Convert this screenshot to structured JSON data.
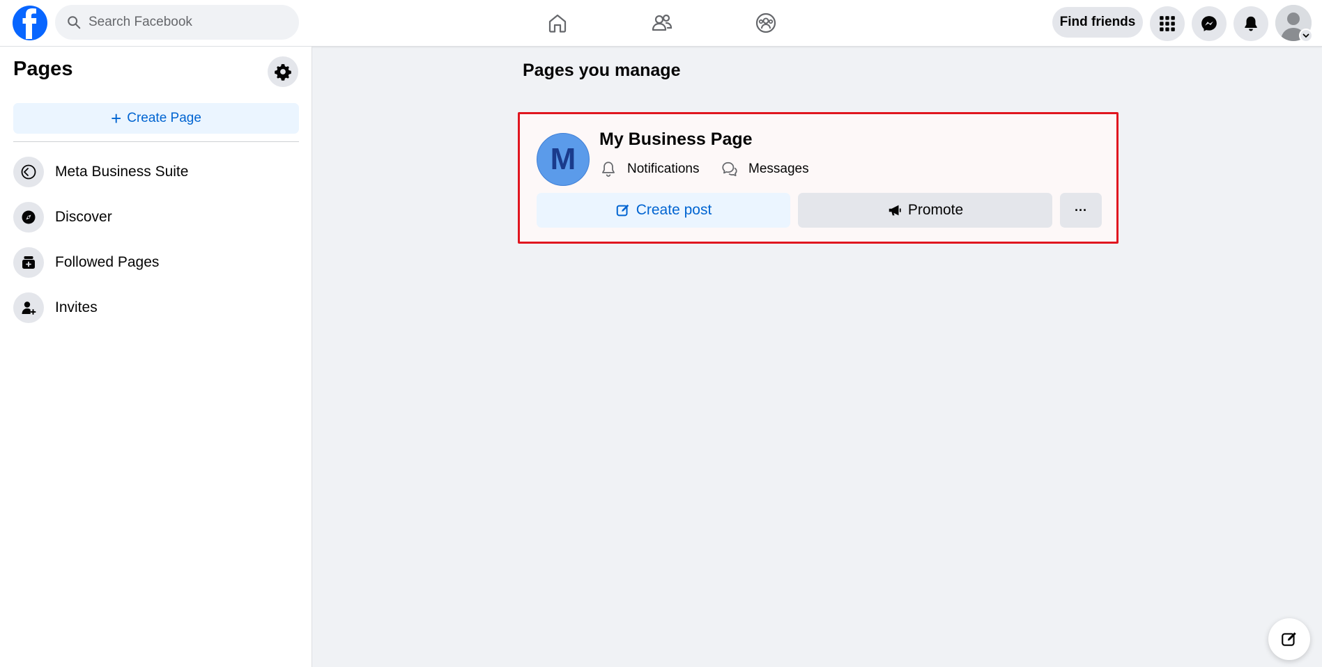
{
  "topbar": {
    "search_placeholder": "Search Facebook",
    "find_friends_label": "Find friends",
    "nav_icons": [
      "home-icon",
      "friends-icon",
      "groups-icon"
    ],
    "right_icons": [
      "menu-grid-icon",
      "messenger-icon",
      "bell-icon",
      "account-avatar"
    ]
  },
  "sidebar": {
    "title": "Pages",
    "create_page_label": "Create Page",
    "items": [
      {
        "label": "Meta Business Suite",
        "icon": "business-suite-icon"
      },
      {
        "label": "Discover",
        "icon": "compass-icon"
      },
      {
        "label": "Followed Pages",
        "icon": "followed-pages-icon"
      },
      {
        "label": "Invites",
        "icon": "invite-person-icon"
      }
    ]
  },
  "main": {
    "title": "Pages you manage",
    "page_card": {
      "avatar_letter": "M",
      "name": "My Business Page",
      "notifications_label": "Notifications",
      "messages_label": "Messages",
      "create_post_label": "Create post",
      "promote_label": "Promote",
      "more_label": "···"
    }
  },
  "colors": {
    "brand_blue": "#0866ff",
    "link_blue": "#0064d1",
    "highlight_border": "#e0161f",
    "background": "#f0f2f5",
    "button_gray": "#e4e6eb"
  }
}
